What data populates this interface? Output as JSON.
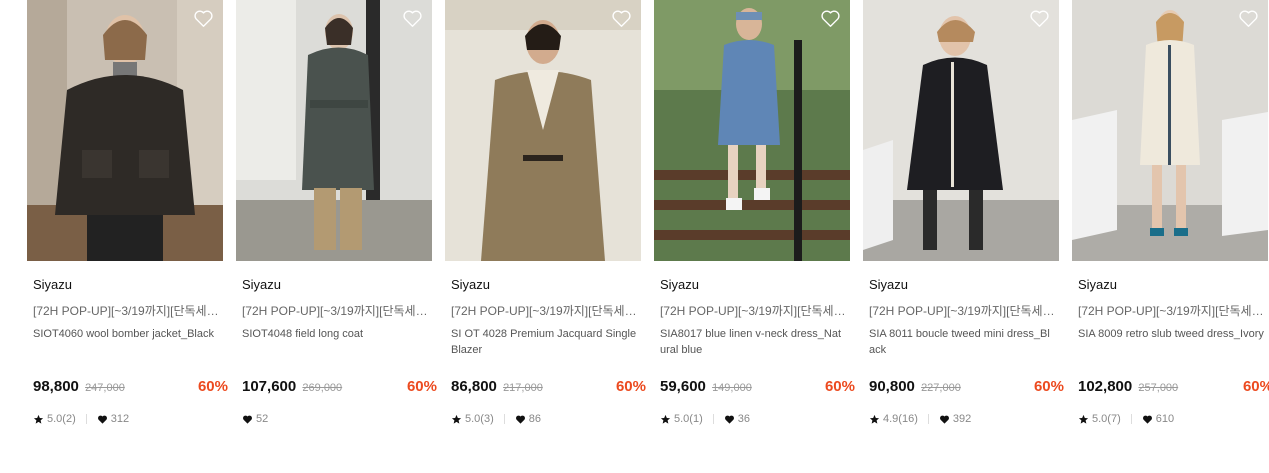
{
  "colors": {
    "discount": "#ec4a1f",
    "text": "#111111",
    "muted": "#888888"
  },
  "icons": {
    "wishlist": "heart-outline-icon",
    "rating": "star-icon",
    "likes": "heart-icon"
  },
  "products": [
    {
      "brand": "Siyazu",
      "promo": "[72H POP-UP][~3/19까지][단독세일...",
      "name": "SIOT4060 wool bomber jacket_Black",
      "price": "98,800",
      "original_price": "247,000",
      "discount": "60%",
      "rating": "5.0(2)",
      "likes": "312"
    },
    {
      "brand": "Siyazu",
      "promo": "[72H POP-UP][~3/19까지][단독세일...",
      "name": "SIOT4048 field long coat",
      "price": "107,600",
      "original_price": "269,000",
      "discount": "60%",
      "rating": "",
      "likes": "52"
    },
    {
      "brand": "Siyazu",
      "promo": "[72H POP-UP][~3/19까지][단독세일]",
      "name": "SI OT 4028 Premium Jacquard Single Blazer",
      "price": "86,800",
      "original_price": "217,000",
      "discount": "60%",
      "rating": "5.0(3)",
      "likes": "86"
    },
    {
      "brand": "Siyazu",
      "promo": "[72H POP-UP][~3/19까지][단독세일]",
      "name": "SIA8017 blue linen v-neck dress_Natural blue",
      "price": "59,600",
      "original_price": "149,000",
      "discount": "60%",
      "rating": "5.0(1)",
      "likes": "36"
    },
    {
      "brand": "Siyazu",
      "promo": "[72H POP-UP][~3/19까지][단독세일]",
      "name": "SIA 8011 boucle tweed mini dress_Black",
      "price": "90,800",
      "original_price": "227,000",
      "discount": "60%",
      "rating": "4.9(16)",
      "likes": "392"
    },
    {
      "brand": "Siyazu",
      "promo": "[72H POP-UP][~3/19까지][단독세일]",
      "name": "SIA 8009 retro slub tweed dress_Ivory",
      "price": "102,800",
      "original_price": "257,000",
      "discount": "60%",
      "rating": "5.0(7)",
      "likes": "610"
    }
  ]
}
